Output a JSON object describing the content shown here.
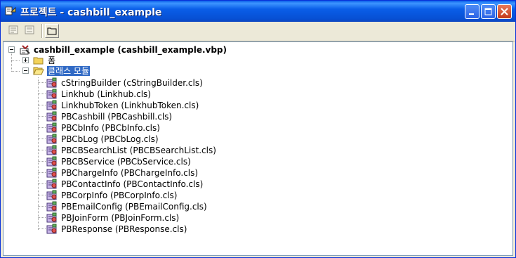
{
  "window": {
    "title": "프로젝트 - cashbill_example",
    "colors": {
      "titlebar": "#0a5ee8",
      "selection": "#316ac5",
      "frame": "#ece9d8"
    }
  },
  "toolbar": {
    "buttons": [
      {
        "icon": "view-code-icon"
      },
      {
        "icon": "view-object-icon"
      },
      {
        "icon": "toggle-folders-icon"
      }
    ]
  },
  "tree": {
    "root": {
      "label": "cashbill_example (cashbill_example.vbp)",
      "icon": "vb-project-icon"
    },
    "folders": [
      {
        "label": "폼",
        "icon": "folder-closed-icon",
        "expanded": false
      },
      {
        "label": "클래스 모듈",
        "icon": "folder-open-icon",
        "expanded": true,
        "selected": true
      }
    ],
    "classes": [
      "cStringBuilder (cStringBuilder.cls)",
      "Linkhub (Linkhub.cls)",
      "LinkhubToken (LinkhubToken.cls)",
      "PBCashbill (PBCashbill.cls)",
      "PBCbInfo (PBCbInfo.cls)",
      "PBCbLog (PBCbLog.cls)",
      "PBCBSearchList (PBCBSearchList.cls)",
      "PBCBService (PBCbService.cls)",
      "PBChargeInfo (PBChargeInfo.cls)",
      "PBContactInfo (PBContactInfo.cls)",
      "PBCorpInfo (PBCorpInfo.cls)",
      "PBEmailConfig (PBEmailConfig.cls)",
      "PBJoinForm (PBJoinForm.cls)",
      "PBResponse (PBResponse.cls)"
    ]
  }
}
